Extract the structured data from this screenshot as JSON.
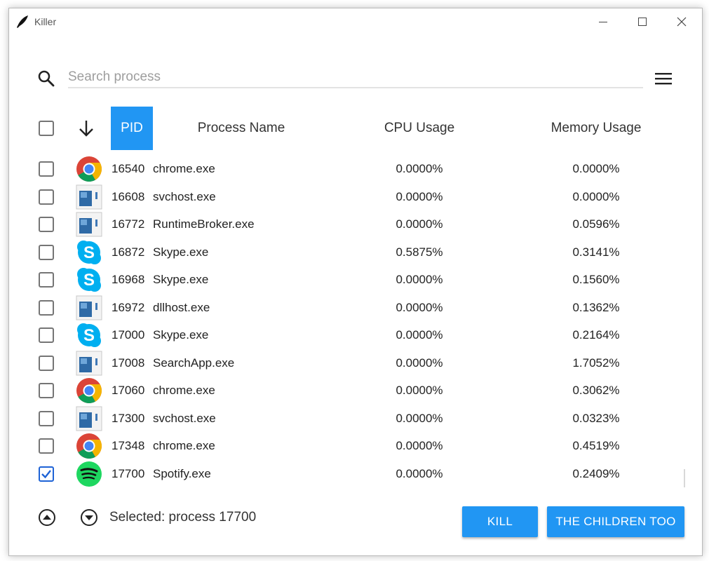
{
  "window": {
    "title": "Killer",
    "icon": "quill-icon",
    "controls": [
      "minimize-icon",
      "maximize-icon",
      "close-icon"
    ]
  },
  "search": {
    "placeholder": "Search process",
    "value": "",
    "icon": "search-icon",
    "menu_icon": "menu-icon"
  },
  "table": {
    "sort_icon": "arrow-down-icon",
    "columns": {
      "pid": "PID",
      "name": "Process Name",
      "cpu": "CPU Usage",
      "memory": "Memory Usage"
    },
    "sorted_by": "PID",
    "accent_color": "#2196f3",
    "rows": [
      {
        "pid": "16540",
        "name": "chrome.exe",
        "cpu": "0.0000%",
        "memory": "0.0000%",
        "icon": "chrome-icon",
        "checked": false
      },
      {
        "pid": "16608",
        "name": "svchost.exe",
        "cpu": "0.0000%",
        "memory": "0.0000%",
        "icon": "generic-app-icon",
        "checked": false
      },
      {
        "pid": "16772",
        "name": "RuntimeBroker.exe",
        "cpu": "0.0000%",
        "memory": "0.0596%",
        "icon": "generic-app-icon",
        "checked": false
      },
      {
        "pid": "16872",
        "name": "Skype.exe",
        "cpu": "0.5875%",
        "memory": "0.3141%",
        "icon": "skype-icon",
        "checked": false
      },
      {
        "pid": "16968",
        "name": "Skype.exe",
        "cpu": "0.0000%",
        "memory": "0.1560%",
        "icon": "skype-icon",
        "checked": false
      },
      {
        "pid": "16972",
        "name": "dllhost.exe",
        "cpu": "0.0000%",
        "memory": "0.1362%",
        "icon": "generic-app-icon",
        "checked": false
      },
      {
        "pid": "17000",
        "name": "Skype.exe",
        "cpu": "0.0000%",
        "memory": "0.2164%",
        "icon": "skype-icon",
        "checked": false
      },
      {
        "pid": "17008",
        "name": "SearchApp.exe",
        "cpu": "0.0000%",
        "memory": "1.7052%",
        "icon": "generic-app-icon",
        "checked": false
      },
      {
        "pid": "17060",
        "name": "chrome.exe",
        "cpu": "0.0000%",
        "memory": "0.3062%",
        "icon": "chrome-icon",
        "checked": false
      },
      {
        "pid": "17300",
        "name": "svchost.exe",
        "cpu": "0.0000%",
        "memory": "0.0323%",
        "icon": "generic-app-icon",
        "checked": false
      },
      {
        "pid": "17348",
        "name": "chrome.exe",
        "cpu": "0.0000%",
        "memory": "0.4519%",
        "icon": "chrome-icon",
        "checked": false
      },
      {
        "pid": "17700",
        "name": "Spotify.exe",
        "cpu": "0.0000%",
        "memory": "0.2409%",
        "icon": "spotify-icon",
        "checked": true
      }
    ]
  },
  "footer": {
    "up_icon": "arrow-up-circle-icon",
    "down_icon": "arrow-down-circle-icon",
    "status": "Selected: process 17700",
    "kill_label": "KILL",
    "children_label": "THE CHILDREN TOO"
  }
}
